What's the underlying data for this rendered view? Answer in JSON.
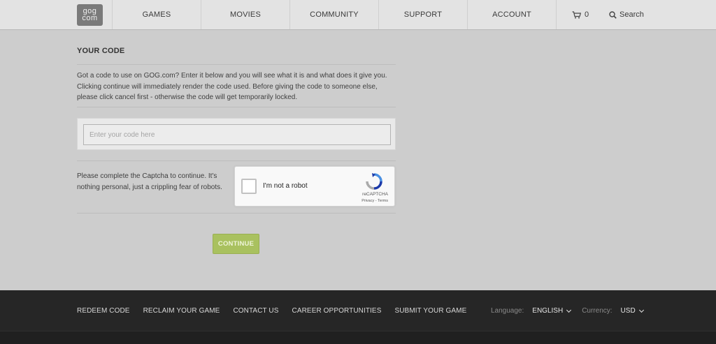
{
  "header": {
    "logo_line1": "gog",
    "logo_line2": "com",
    "nav": [
      "GAMES",
      "MOVIES",
      "COMMUNITY",
      "SUPPORT",
      "ACCOUNT"
    ],
    "cart_count": "0",
    "search_label": "Search"
  },
  "main": {
    "title": "YOUR CODE",
    "intro": "Got a code to use on GOG.com? Enter it below and you will see what it is and what does it give you. Clicking continue will immediately render the code used. Before giving the code to someone else, please click cancel first - otherwise the code will get temporarily locked.",
    "code_placeholder": "Enter your code here",
    "captcha_text": "Please complete the Captcha to continue. It's nothing personal, just a crippling fear of robots.",
    "recaptcha": {
      "label": "I'm not a robot",
      "brand": "reCAPTCHA",
      "links": "Privacy - Terms"
    },
    "continue_label": "CONTINUE"
  },
  "footer": {
    "links": [
      "REDEEM CODE",
      "RECLAIM YOUR GAME",
      "CONTACT US",
      "CAREER OPPORTUNITIES",
      "SUBMIT YOUR GAME"
    ],
    "language_label": "Language:",
    "language_value": "ENGLISH",
    "currency_label": "Currency:",
    "currency_value": "USD"
  },
  "colors": {
    "accent_button": "#a9c15f",
    "page_bg": "#cdcdcd",
    "footer_bg": "#262626"
  }
}
